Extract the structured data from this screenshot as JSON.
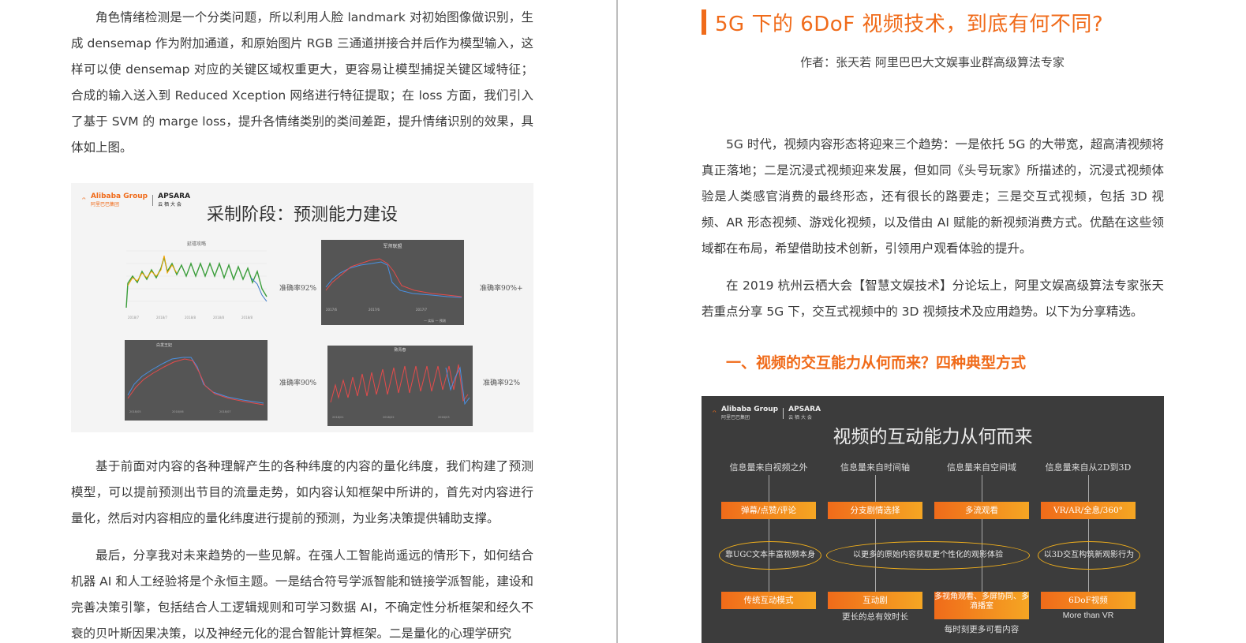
{
  "left_page": {
    "para1": "角色情绪检测是一个分类问题，所以利用人脸 landmark 对初始图像做识别，生成 densemap 作为附加通道，和原始图片 RGB 三通道拼接合并后作为模型输入，这样可以使 densemap 对应的关键区域权重更大，更容易让模型捕捉关键区域特征；合成的输入送入到 Reduced Xception 网络进行特征提取；在 loss 方面，我们引入了基于 SVM 的 marge loss，提升各情绪类别的类间差距，提升情绪识别的效果，具体如上图。",
    "slide": {
      "logo_alibaba": "Alibaba Group",
      "logo_alibaba_sub": "阿里巴巴集团",
      "logo_apsara": "APSARA",
      "logo_apsara_sub": "云 栖 大 会",
      "title": "采制阶段：预测能力建设",
      "charts": [
        {
          "title": "延禧攻略",
          "accuracy": "准确率92%"
        },
        {
          "title": "军师联盟",
          "accuracy": "准确率90%+"
        },
        {
          "title": "白发王妃",
          "accuracy": "准确率90%"
        },
        {
          "title": "致青春",
          "accuracy": "准确率92%"
        }
      ]
    },
    "para2": "基于前面对内容的各种理解产生的各种纬度的内容的量化纬度，我们构建了预测模型，可以提前预测出节目的流量走势，如内容认知框架中所讲的，首先对内容进行量化，然后对内容相应的量化纬度进行提前的预测，为业务决策提供辅助支撑。",
    "para3": "最后，分享我对未来趋势的一些见解。在强人工智能尚遥远的情形下，如何结合机器 AI 和人工经验将是个永恒主题。一是结合符号学派智能和链接学派智能，建设和完善决策引擎，包括结合人工逻辑规则和可学习数据 AI，不确定性分析框架和经久不衰的贝叶斯因果决策，以及神经元化的混合智能计算框架。二是量化的心理学研究"
  },
  "right_page": {
    "title": "5G 下的 6DoF 视频技术，到底有何不同?",
    "author": "作者：张天若    阿里巴巴大文娱事业群高级算法专家",
    "para1": "5G 时代，视频内容形态将迎来三个趋势：一是依托 5G 的大带宽，超高清视频将真正落地；二是沉浸式视频迎来发展，但如同《头号玩家》所描述的，沉浸式视频体验是人类感官消费的最终形态，还有很长的路要走；三是交互式视频，包括 3D 视频、AR 形态视频、游戏化视频，以及借由 AI 赋能的新视频消费方式。优酷在这些领域都在布局，希望借助技术创新，引领用户观看体验的提升。",
    "para2": "在 2019 杭州云栖大会【智慧文娱技术】分论坛上，阿里文娱高级算法专家张天若重点分享 5G 下，交互式视频中的 3D 视频技术及应用趋势。以下为分享精选。",
    "section_title": "一、视频的交互能力从何而来？四种典型方式",
    "slide": {
      "logo_alibaba": "Alibaba Group",
      "logo_alibaba_sub": "阿里巴巴集团",
      "logo_apsara": "APSARA",
      "logo_apsara_sub": "云 栖 大 会",
      "title": "视频的互动能力从何而来",
      "columns": [
        {
          "head": "信息量来自视频之外",
          "box1": "弹幕/点赞/评论",
          "box2": "传统互动模式",
          "sub": ""
        },
        {
          "head": "信息量来自时间轴",
          "box1": "分支剧情选择",
          "box2": "互动剧",
          "sub": "更长的总有效时长"
        },
        {
          "head": "信息量来自空间域",
          "box1": "多流观看",
          "box2": "多视角观看、多屏协同、多滴播室",
          "sub": "每时刻更多可看内容"
        },
        {
          "head": "信息量来自从2D到3D",
          "box1": "VR/AR/全息/360°",
          "box2": "6DoF视频",
          "sub": "More than VR"
        }
      ],
      "ellipses": [
        "靠UGC文本丰富视频本身",
        "以更多的原始内容获取更个性化的观影体验",
        "以3D交互构筑新观影行为"
      ]
    }
  }
}
